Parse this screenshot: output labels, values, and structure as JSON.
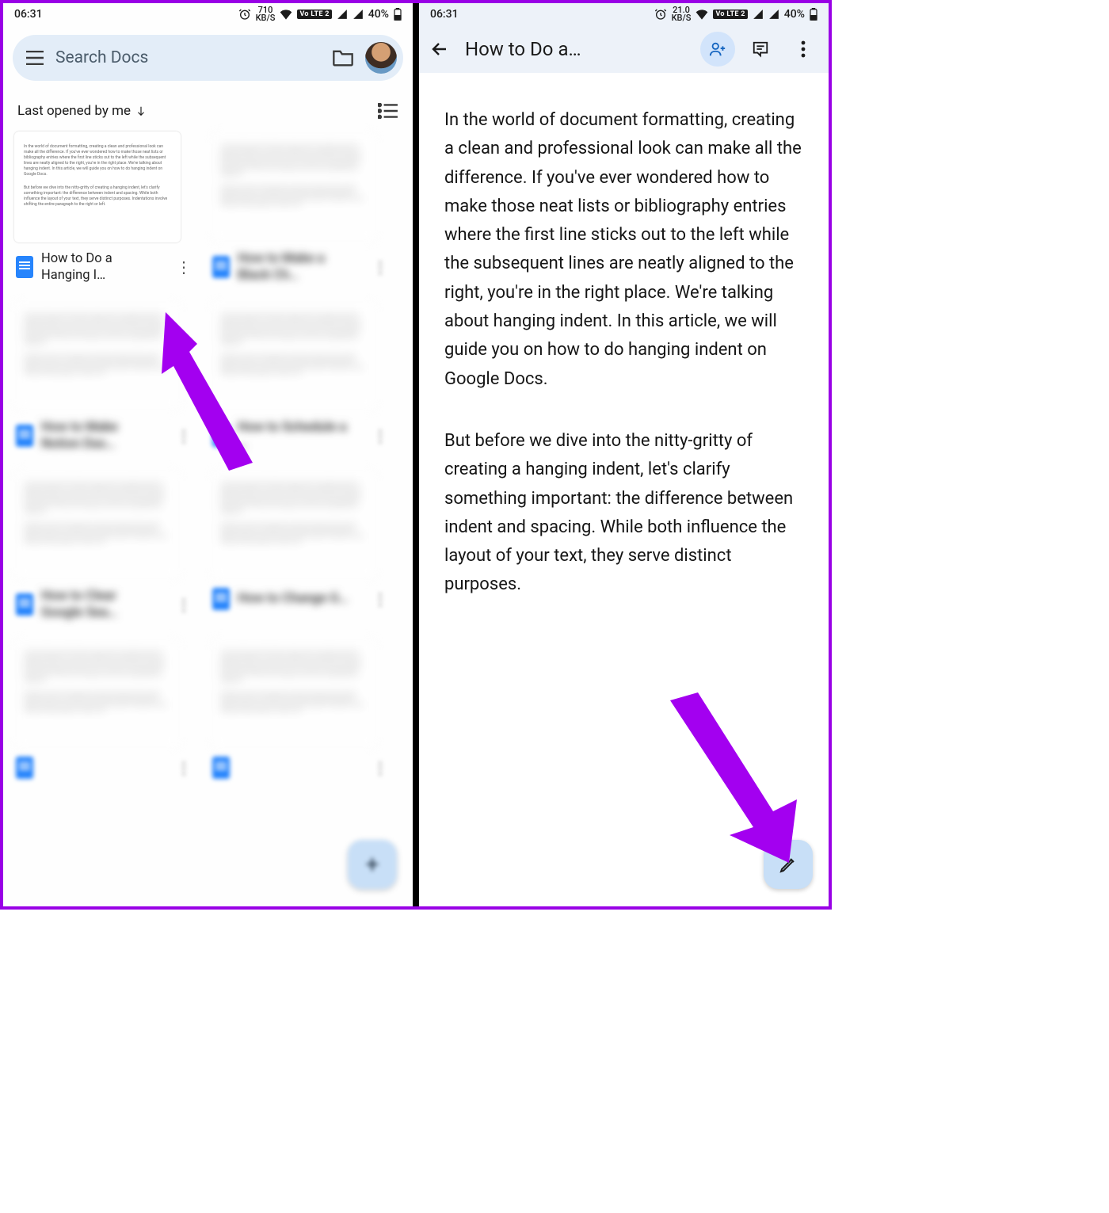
{
  "status": {
    "time": "06:31",
    "net_left": {
      "speed": "710",
      "unit": "KB/S"
    },
    "net_right": {
      "speed": "21.0",
      "unit": "KB/S"
    },
    "lte_badge": "Vo LTE 2",
    "battery": "40%"
  },
  "left": {
    "search_placeholder": "Search Docs",
    "sort_label": "Last opened by me",
    "docs": [
      {
        "title": "How to Do a Hanging I…",
        "blurred": false
      },
      {
        "title": "How to Make a Black Ch…",
        "blurred": true
      },
      {
        "title": "How to Make Notion Das…",
        "blurred": true
      },
      {
        "title": "How to Schedule a …",
        "blurred": true
      },
      {
        "title": "How to Clear Google Sea…",
        "blurred": true
      },
      {
        "title": "How to Change G…",
        "blurred": true
      },
      {
        "title": "",
        "blurred": true
      },
      {
        "title": "",
        "blurred": true
      }
    ],
    "fab_label": "+"
  },
  "right": {
    "title": "How to Do a…",
    "paragraph1": "In the world of document formatting, creating a clean and professional look can make all the difference. If you've ever wondered how to make those neat lists or bibliography entries where the first line sticks out to the left while the subsequent lines are neatly aligned to the right, you're in the right place. We're talking about hanging indent. In this article, we will guide you on how to do hanging indent on Google Docs.",
    "paragraph2": "But before we dive into the nitty-gritty of creating a hanging indent, let's clarify something important: the difference between indent and spacing. While both influence the layout of your text, they serve distinct purposes."
  },
  "colors": {
    "accent": "#c8dff7",
    "arrow": "#a300f0"
  }
}
